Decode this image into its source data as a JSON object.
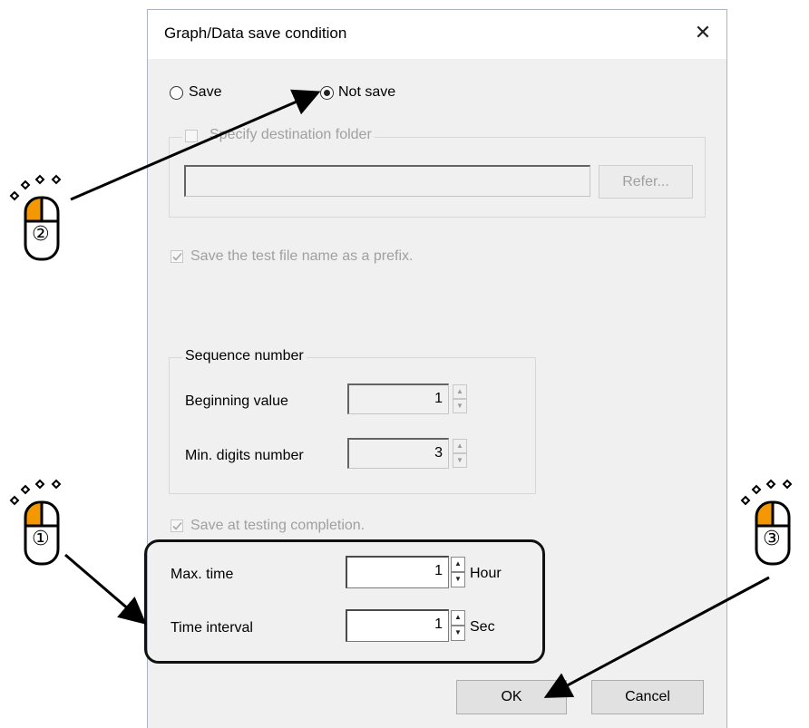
{
  "dialog": {
    "title": "Graph/Data save condition",
    "close_glyph": "✕"
  },
  "save_mode": {
    "options": [
      {
        "label": "Save",
        "checked": false
      },
      {
        "label": "Not save",
        "checked": true
      }
    ]
  },
  "destination": {
    "checkbox_label": "Specify destination folder",
    "path_value": "",
    "refer_label": "Refer..."
  },
  "prefix_checkbox": {
    "label": "Save the test file name as a prefix.",
    "checked": true
  },
  "sequence": {
    "legend": "Sequence number",
    "beginning_label": "Beginning value",
    "beginning_value": "1",
    "digits_label": "Min. digits number",
    "digits_value": "3"
  },
  "completion_checkbox": {
    "label": "Save at testing completion.",
    "checked": true
  },
  "max_time": {
    "label": "Max. time",
    "value": "1",
    "unit": "Hour"
  },
  "time_interval": {
    "label": "Time interval",
    "value": "1",
    "unit": "Sec"
  },
  "buttons": {
    "ok": "OK",
    "cancel": "Cancel"
  },
  "annotations": {
    "step1": "①",
    "step2": "②",
    "step3": "③",
    "mouse_icon": "mouse-left-click-icon",
    "accent_color": "#f39800"
  }
}
